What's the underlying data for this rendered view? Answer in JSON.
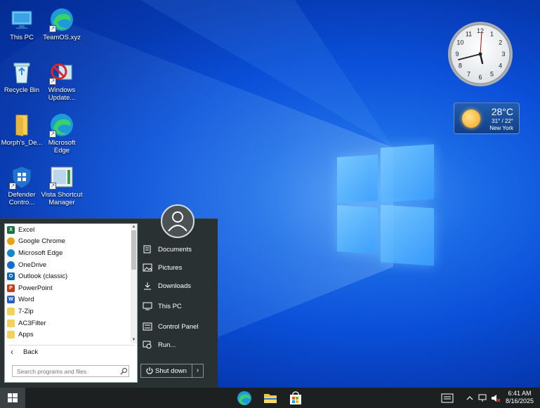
{
  "desktop": {
    "icons": [
      {
        "label": "This PC",
        "icon": "this-pc-icon"
      },
      {
        "label": "TeamOS.xyz",
        "icon": "edge-shortcut-icon"
      },
      {
        "label": "Recycle Bin",
        "icon": "recycle-bin-icon"
      },
      {
        "label": "Windows Update...",
        "icon": "windows-update-icon"
      },
      {
        "label": "Morph's_De...",
        "icon": "folder-icon"
      },
      {
        "label": "Microsoft Edge",
        "icon": "edge-icon"
      },
      {
        "label": "Defender Contro...",
        "icon": "defender-shield-icon"
      },
      {
        "label": "Vista Shortcut Manager",
        "icon": "shortcut-manager-icon"
      }
    ]
  },
  "gadgets": {
    "clock": {
      "numbers": [
        "12",
        "1",
        "2",
        "3",
        "4",
        "5",
        "6",
        "7",
        "8",
        "9",
        "10",
        "11"
      ]
    },
    "weather": {
      "temp": "28°C",
      "range": "31° / 22°",
      "city": "New York"
    }
  },
  "start_menu": {
    "programs": [
      {
        "label": "Excel",
        "color": "#1d7044",
        "glyph": "X"
      },
      {
        "label": "Google Chrome",
        "color": "#e8a318",
        "glyph": ""
      },
      {
        "label": "Microsoft Edge",
        "color": "#1585c9",
        "glyph": ""
      },
      {
        "label": "OneDrive",
        "color": "#0f6cd0",
        "glyph": ""
      },
      {
        "label": "Outlook (classic)",
        "color": "#0a64c2",
        "glyph": "O"
      },
      {
        "label": "PowerPoint",
        "color": "#c43e1c",
        "glyph": "P"
      },
      {
        "label": "Word",
        "color": "#2b5db9",
        "glyph": "W"
      },
      {
        "label": "7-Zip",
        "color": "#f3d15b",
        "glyph": ""
      },
      {
        "label": "AC3Filter",
        "color": "#f3d15b",
        "glyph": ""
      },
      {
        "label": "Apps",
        "color": "#f3d15b",
        "glyph": ""
      }
    ],
    "back_label": "Back",
    "search_placeholder": "Search programs and files",
    "right_items": [
      {
        "label": "Documents",
        "icon": "documents-icon"
      },
      {
        "label": "Pictures",
        "icon": "pictures-icon"
      },
      {
        "label": "Downloads",
        "icon": "downloads-icon"
      },
      {
        "label": "This PC",
        "icon": "computer-icon"
      },
      {
        "label": "Control Panel",
        "icon": "control-panel-icon"
      },
      {
        "label": "Run...",
        "icon": "run-icon"
      }
    ],
    "shutdown_label": "Shut down"
  },
  "taskbar": {
    "apps": [
      "edge-icon",
      "file-explorer-icon",
      "store-icon"
    ],
    "time": "6:41 AM",
    "date": "8/16/2025"
  }
}
